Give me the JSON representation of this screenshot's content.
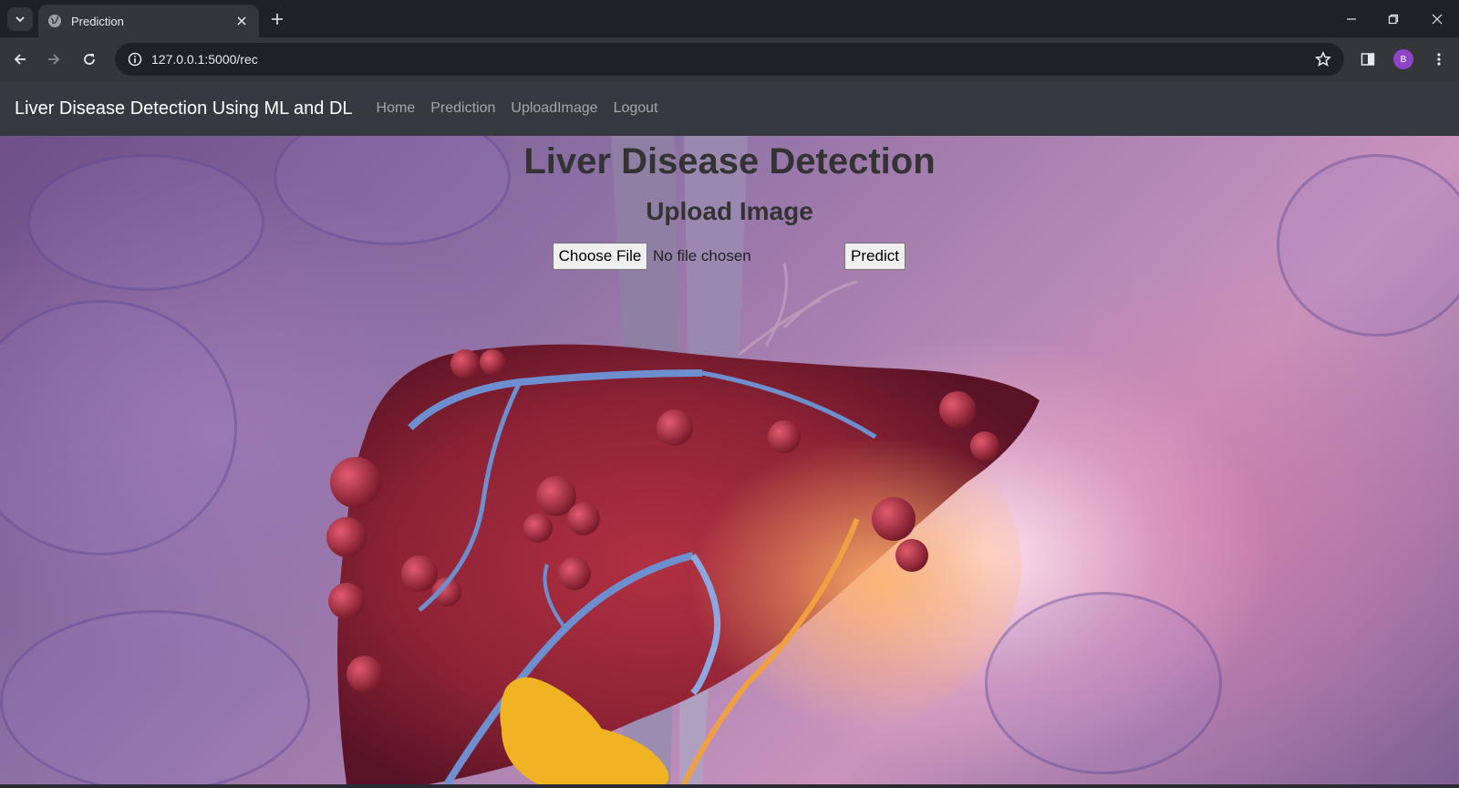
{
  "browser": {
    "tab_title": "Prediction",
    "url": "127.0.0.1:5000/rec",
    "profile_initial": "B"
  },
  "navbar": {
    "brand": "Liver Disease Detection Using ML and DL",
    "links": [
      "Home",
      "Prediction",
      "UploadImage",
      "Logout"
    ]
  },
  "main": {
    "title": "Liver Disease Detection",
    "subtitle": "Upload Image",
    "file_input": {
      "button_label": "Choose File",
      "status": "No file chosen"
    },
    "predict_label": "Predict"
  },
  "colors": {
    "navbar_bg": "#343a40",
    "chrome_bg": "#202124",
    "toolbar_bg": "#35363a",
    "liver": "#8e2335",
    "vessel": "#6d8fd0",
    "gallbladder": "#f0b323"
  },
  "icons": [
    "tab-search-icon",
    "globe-icon",
    "close-icon",
    "plus-icon",
    "minimize-icon",
    "restore-icon",
    "back-icon",
    "forward-icon",
    "reload-icon",
    "info-icon",
    "star-icon",
    "side-panel-icon",
    "menu-dots-icon"
  ]
}
